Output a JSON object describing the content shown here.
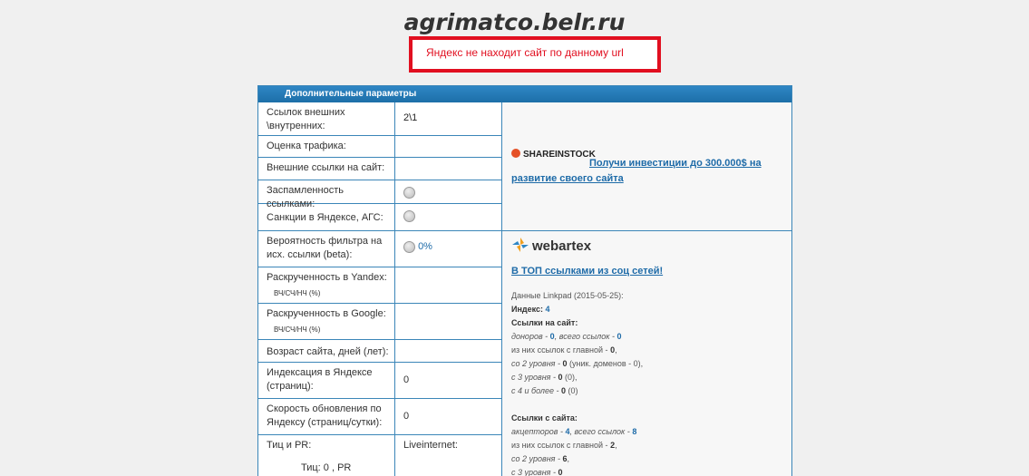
{
  "site_title": "agrimatco.belr.ru",
  "alert": "Яндекс не находит сайт по данному url",
  "panel": {
    "header": "Дополнительные параметры",
    "rows": [
      {
        "label": "Ссылок внешних \\внутренних:",
        "value": "2\\1"
      },
      {
        "label": "Оценка трафика:",
        "value": ""
      },
      {
        "label": "Внешние ссылки на сайт:",
        "value": ""
      },
      {
        "label": "Заспамленность ссылками:",
        "value": ""
      },
      {
        "label": "Санкции в Яндексе, АГС:",
        "value": ""
      },
      {
        "label": "Вероятность фильтра на исх. ссылки (beta):",
        "value": "0%"
      },
      {
        "label": "Раскрученность в Yandex:",
        "sub": "ВЧ/СЧ/НЧ (%)",
        "value": ""
      },
      {
        "label": "Раскрученность в Google:",
        "sub": "ВЧ/СЧ/НЧ (%)",
        "value": ""
      },
      {
        "label": "Возраст сайта, дней (лет):",
        "value": ""
      },
      {
        "label": "Индексация в Яндексе (страниц):",
        "value": "0"
      },
      {
        "label": "Скорость обновления по Яндексу (страниц/сутки):",
        "value": "0"
      },
      {
        "label": "Тиц и PR:",
        "value": "Liveinternet:",
        "sub": "Тиц: 0 , PR"
      }
    ]
  },
  "ads": {
    "shareinstock": {
      "logo": "SHAREINSTOCK",
      "link": "Получи инвестиции до 300.000$ на развитие своего сайта"
    },
    "webartex": {
      "logo": "webartex",
      "link": "В ТОП ссылками из соц сетей!"
    }
  },
  "linkpad": {
    "heading": "Данные Linkpad (2015-05-25):",
    "index_label": "Индекс:",
    "index_value": "4",
    "in_links_title": "Ссылки на сайт:",
    "donors_label": "доноров -",
    "donors": "0",
    "total_label": ", всего ссылок -",
    "total": "0",
    "from_main_label": "из них ссылок с главной -",
    "from_main": "0",
    "level2_label": "со 2 уровня -",
    "level2": "0",
    "level2_extra": "(уник. доменов - 0),",
    "level3_label": "с 3 уровня -",
    "level3": "0",
    "level3_extra": "(0),",
    "level4_label": "с 4 и более -",
    "level4": "0",
    "level4_extra": "(0)",
    "out_links_title": "Ссылки с сайта:",
    "acceptors_label": "акцепторов -",
    "acceptors": "4",
    "out_total_label": ", всего ссылок -",
    "out_total": "8",
    "out_from_main_label": "из них ссылок с главной -",
    "out_from_main": "2",
    "out_level2_label": "со 2 уровня -",
    "out_level2": "6",
    "out_level3_label": "с 3 уровня -",
    "out_level3": "0"
  }
}
